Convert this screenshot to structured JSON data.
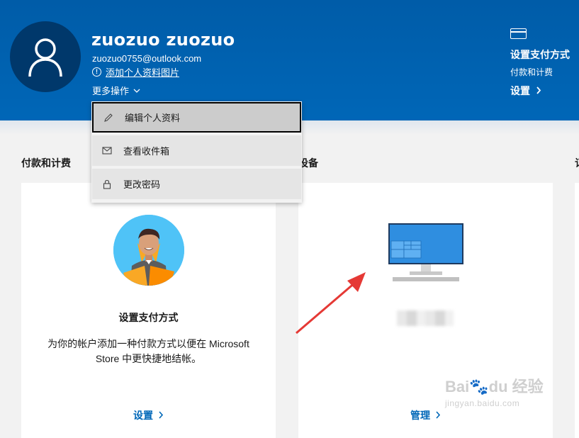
{
  "header": {
    "user_name": "zuozuo zuozuo",
    "email": "zuozuo0755@outlook.com",
    "add_photo": "添加个人资料图片",
    "more_actions": "更多操作"
  },
  "payment_side": {
    "title": "设置支付方式",
    "subtitle": "付款和计费",
    "link": "设置",
    "icon": "credit-card-icon"
  },
  "dropdown": {
    "items": [
      {
        "label": "编辑个人资料",
        "icon": "pencil-icon"
      },
      {
        "label": "查看收件箱",
        "icon": "mail-icon"
      },
      {
        "label": "更改密码",
        "icon": "lock-icon"
      }
    ]
  },
  "sections": {
    "payment_title": "付款和计费",
    "devices_title": "设备",
    "third_title": "订"
  },
  "payment_card": {
    "title": "设置支付方式",
    "description": "为你的帐户添加一种付款方式以便在 Microsoft Store 中更快捷地结帐。",
    "link": "设置"
  },
  "devices_card": {
    "link": "管理"
  },
  "watermark": {
    "brand": "Bai",
    "paw": "du",
    "suffix": "经验",
    "url": "jingyan.baidu.com"
  },
  "colors": {
    "header_blue": "#0067b8",
    "link_blue": "#0067b8",
    "arrow_red": "#e53935"
  }
}
